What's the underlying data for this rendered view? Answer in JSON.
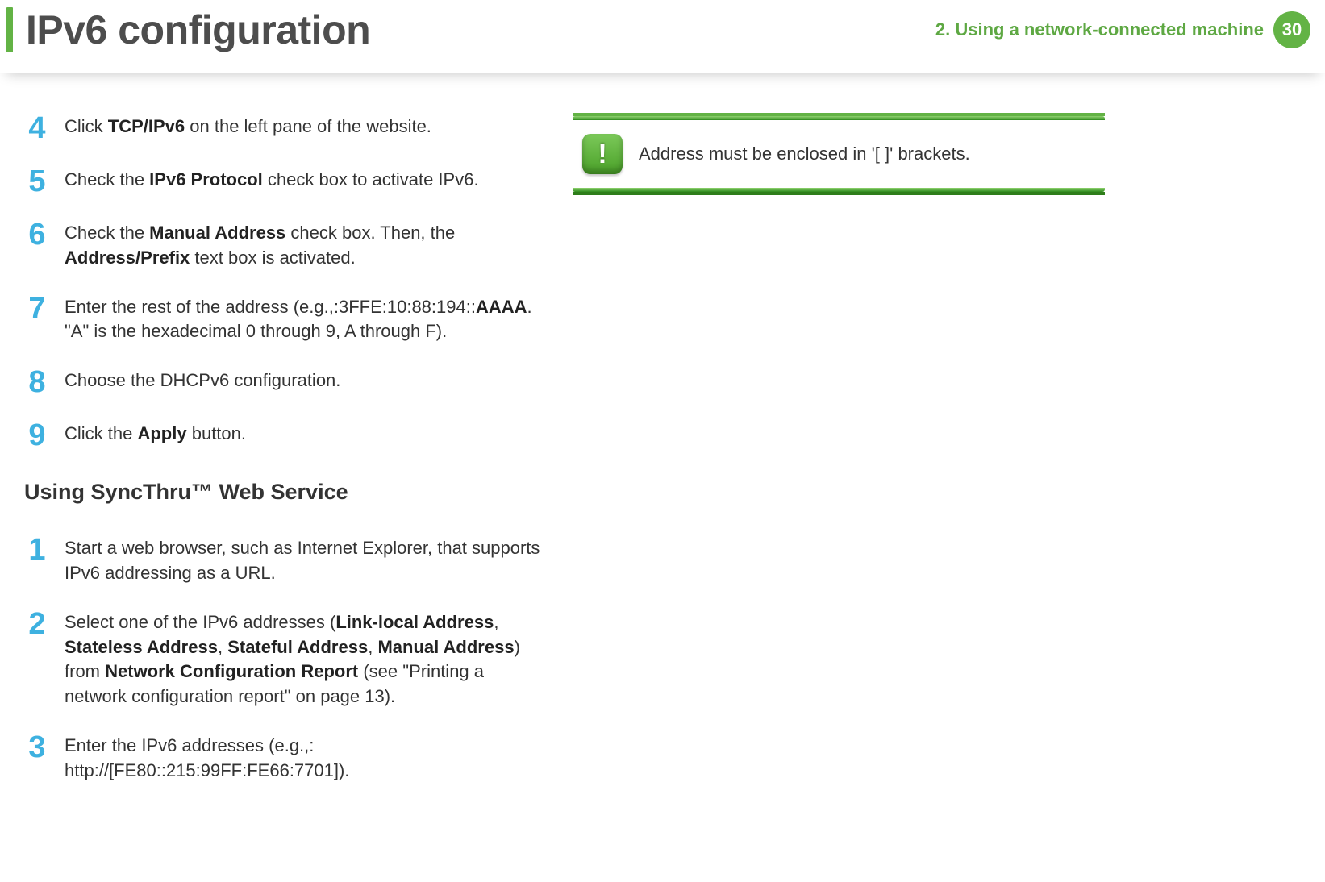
{
  "header": {
    "title": "IPv6 configuration",
    "chapter_label": "2.   Using a network-connected machine",
    "page_number": "30"
  },
  "left_column": {
    "steps_a": [
      {
        "num": "4",
        "html": "Click <b>TCP/IPv6</b> on the left pane of the website."
      },
      {
        "num": "5",
        "html": "Check the <b>IPv6 Protocol</b> check box to activate IPv6."
      },
      {
        "num": "6",
        "html": "Check the <b>Manual Address</b> check box. Then, the <b>Address/Prefix</b> text box is activated."
      },
      {
        "num": "7",
        "html": "Enter the rest of the address (e.g.,:3FFE:10:88:194::<b>AAAA</b>. \"A\" is the hexadecimal 0 through 9, A through F)."
      },
      {
        "num": "8",
        "html": "Choose the DHCPv6 configuration."
      },
      {
        "num": "9",
        "html": "Click the <b>Apply</b> button."
      }
    ],
    "section_heading": "Using SyncThru™ Web Service",
    "steps_b": [
      {
        "num": "1",
        "html": "Start a web browser, such as Internet Explorer, that supports IPv6 addressing as a URL."
      },
      {
        "num": "2",
        "html": "Select one of the IPv6 addresses (<b>Link-local Address</b>, <b>Stateless Address</b>, <b>Stateful Address</b>, <b>Manual Address</b>) from <b>Network Configuration Report</b> (see \"Printing a network configuration report\" on page 13)."
      },
      {
        "num": "3",
        "html": "Enter the IPv6 addresses (e.g.,: http://[FE80::215:99FF:FE66:7701])."
      }
    ]
  },
  "right_column": {
    "note_icon_glyph": "!",
    "note_text": "Address must be enclosed in '[ ]' brackets."
  }
}
